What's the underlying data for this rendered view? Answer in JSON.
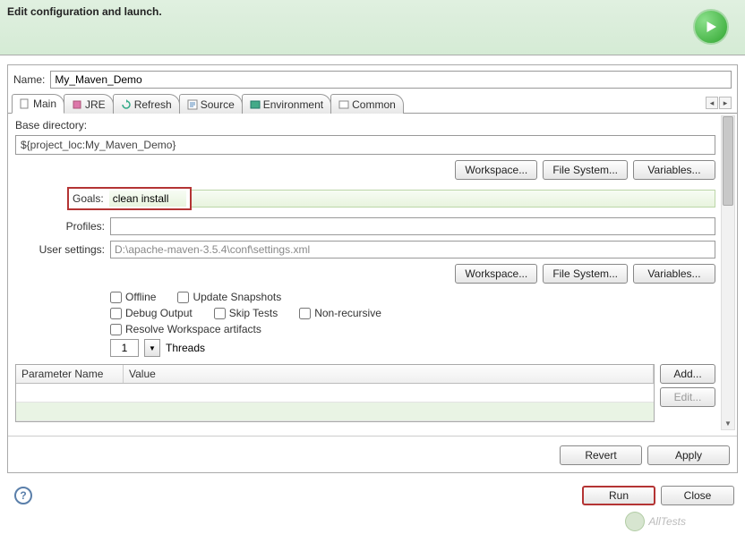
{
  "header": {
    "title": "Edit configuration and launch."
  },
  "name": {
    "label": "Name:",
    "value": "My_Maven_Demo"
  },
  "tabs": [
    {
      "label": "Main"
    },
    {
      "label": "JRE"
    },
    {
      "label": "Refresh"
    },
    {
      "label": "Source"
    },
    {
      "label": "Environment"
    },
    {
      "label": "Common"
    }
  ],
  "main": {
    "base_dir_label": "Base directory:",
    "base_dir_value": "${project_loc:My_Maven_Demo}",
    "workspace_btn": "Workspace...",
    "filesystem_btn": "File System...",
    "variables_btn": "Variables...",
    "goals_label": "Goals:",
    "goals_value": "clean install",
    "profiles_label": "Profiles:",
    "profiles_value": "",
    "user_settings_label": "User settings:",
    "user_settings_value": "D:\\apache-maven-3.5.4\\conf\\settings.xml",
    "checks": {
      "offline": "Offline",
      "update_snapshots": "Update Snapshots",
      "debug_output": "Debug Output",
      "skip_tests": "Skip Tests",
      "non_recursive": "Non-recursive",
      "resolve_ws": "Resolve Workspace artifacts"
    },
    "threads_value": "1",
    "threads_label": "Threads",
    "param_table": {
      "col_name": "Parameter Name",
      "col_value": "Value",
      "add_btn": "Add...",
      "edit_btn": "Edit..."
    }
  },
  "bottom": {
    "revert": "Revert",
    "apply": "Apply"
  },
  "footer": {
    "run": "Run",
    "close": "Close"
  },
  "watermark": "AllTests"
}
